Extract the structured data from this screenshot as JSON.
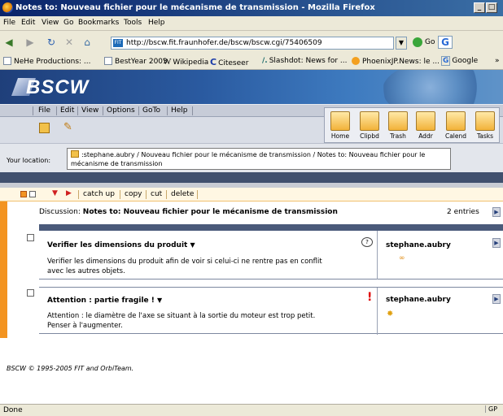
{
  "window": {
    "title": "Notes to: Nouveau fichier pour le mécanisme de transmission - Mozilla Firefox"
  },
  "firefox_menu": [
    "File",
    "Edit",
    "View",
    "Go",
    "Bookmarks",
    "Tools",
    "Help"
  ],
  "address": {
    "url": "http://bscw.fit.fraunhofer.de/bscw/bscw.cgi/75406509",
    "go_label": "Go"
  },
  "bookmarks": [
    "NeHe Productions: ...",
    "BestYear 2003",
    "Wikipedia",
    "Citeseer",
    "Slashdot: News for ...",
    "PhoenixJP.News: le ...",
    "Google"
  ],
  "bscw": {
    "logo": "BSCW",
    "menu": [
      "File",
      "Edit",
      "View",
      "Options",
      "GoTo",
      "Help"
    ],
    "toolbar": [
      "Home",
      "Clipbd",
      "Trash",
      "Addr",
      "Calend",
      "Tasks"
    ]
  },
  "location": {
    "label": "Your location:",
    "path": ":stephane.aubry / Nouveau fichier pour le mécanisme de transmission / Notes to: Nouveau fichier pour le mécanisme de transmission"
  },
  "actions": [
    "catch up",
    "copy",
    "cut",
    "delete"
  ],
  "discussion": {
    "label": "Discussion:",
    "title": "Notes to: Nouveau fichier pour le mécanisme de transmission",
    "count": "2 entries"
  },
  "entries": [
    {
      "title": "Verifier les dimensions du produit",
      "body": "Verifier les dimensions du produit afin de voir si celui-ci ne rentre pas en conflit avec les autres objets.",
      "author": "stephane.aubry",
      "marker": "?"
    },
    {
      "title": "Attention : partie fragile !",
      "body": "Attention : le diamètre de l'axe se situant à la sortie du moteur est trop petit. Penser à l'augmenter.",
      "author": "stephane.aubry",
      "marker": "!"
    }
  ],
  "footer": "BSCW © 1995-2005 FIT and OrbiTeam.",
  "status": {
    "text": "Done",
    "right": "GP"
  },
  "colors": {
    "accent_orange": "#f39421",
    "navy": "#40506e",
    "alert_red": "#e00000"
  }
}
